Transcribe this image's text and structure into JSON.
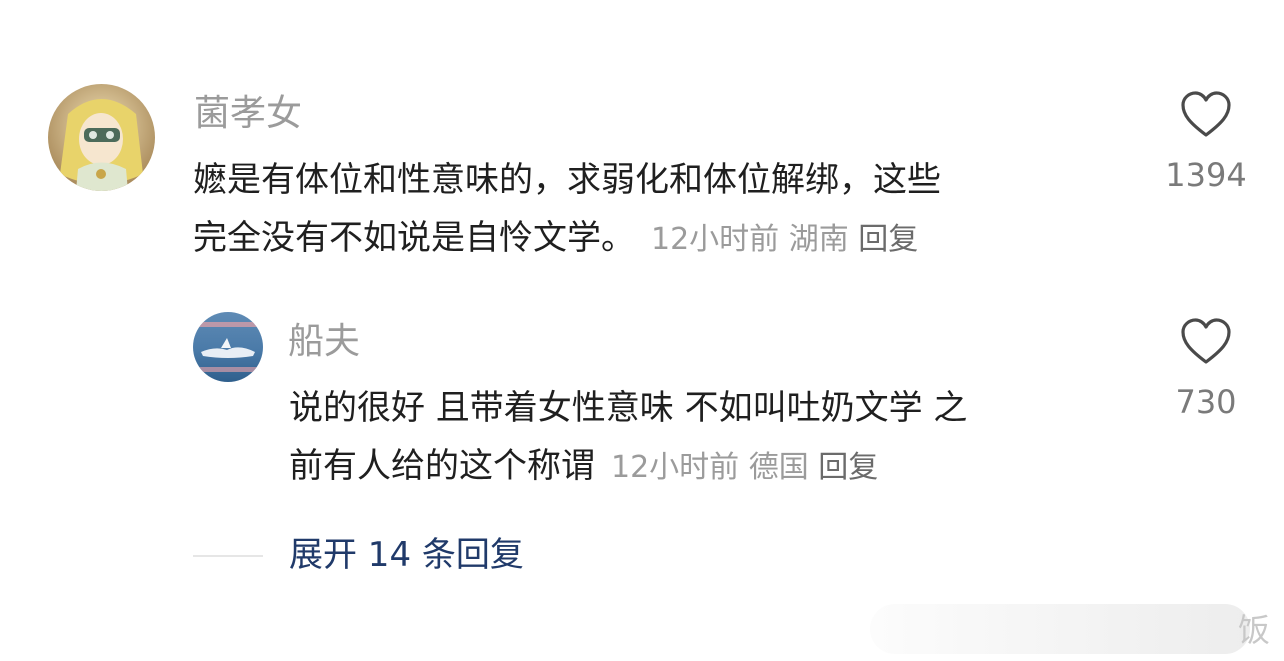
{
  "comments": [
    {
      "username": "菌孝女",
      "text_line1": "嬷是有体位和性意味的，求弱化和体位解绑，这些",
      "text_line2": "完全没有不如说是自怜文学。",
      "time": "12小时前",
      "location": "湖南",
      "reply_label": "回复",
      "like_icon": "heart-outline-icon",
      "likes": "1394"
    },
    {
      "username": "船夫",
      "text_line1": "说的很好 且带着女性意味 不如叫吐奶文学 之",
      "text_line2": "前有人给的这个称谓",
      "time": "12小时前",
      "location": "德国",
      "reply_label": "回复",
      "like_icon": "heart-outline-icon",
      "likes": "730"
    }
  ],
  "expand_replies": "展开 14 条回复",
  "watermark": "饭",
  "colors": {
    "username": "#9b9b9b",
    "body": "#1f1f1f",
    "meta": "#9b9b9b",
    "link": "#203a6a"
  }
}
